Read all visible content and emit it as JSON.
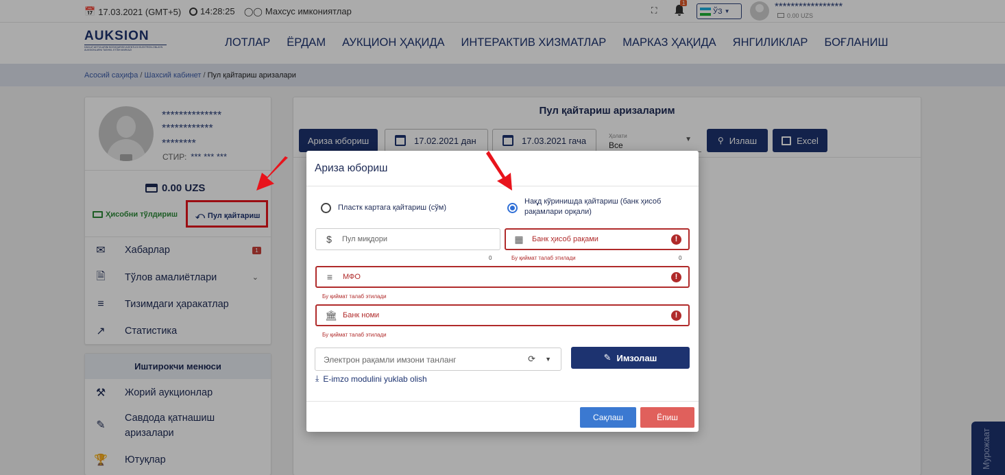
{
  "topbar": {
    "date": "17.03.2021 (GMT+5)",
    "time": "14:28:25",
    "accessibility": "Махсус имкониятлар",
    "notif_count": "1",
    "lang": "ЎЗ",
    "user_stars": "*****************",
    "balance": "0.00 UZS"
  },
  "nav": {
    "logo_text": "AUKSION",
    "logo_sub": "DAVLAT AKTIVLARINI BOSHQARISH AGENTLIGI ELEKTRON-ONLAYN AUKSIONLARNI TASHKIL ETISH MARKAZI",
    "links": [
      "ЛОТЛАР",
      "ЁРДАМ",
      "АУКЦИОН ҲАҚИДА",
      "ИНТЕРАКТИВ ХИЗМАТЛАР",
      "МАРКАЗ ҲАҚИДА",
      "ЯНГИЛИКЛАР",
      "БОҒЛАНИШ"
    ]
  },
  "breadcrumb": {
    "home": "Асосий саҳифа",
    "cabinet": "Шахсий кабинет",
    "current": "Пул қайтариш аризалари"
  },
  "profile": {
    "name_line1": "**************",
    "name_line2": "************",
    "name_line3": "********",
    "stir_label": "СТИР:",
    "stir_value": "*** *** ***",
    "balance": "0.00 UZS",
    "fill_label": "Ҳисобни тўлдириш",
    "refund_label": "Пул қайтариш"
  },
  "menu": [
    {
      "label": "Хабарлар",
      "badge": "1"
    },
    {
      "label": "Тўлов амалиётлари"
    },
    {
      "label": "Тизимдаги ҳаракатлар"
    },
    {
      "label": "Статистика"
    }
  ],
  "participant_menu": {
    "title": "Иштирокчи менюси",
    "items": [
      "Жорий аукционлар",
      "Савдода қатнашиш аризалари",
      "Ютуқлар"
    ]
  },
  "main": {
    "title": "Пул қайтариш аризаларим",
    "send_button": "Ариза юбориш",
    "date_from": "17.02.2021 дан",
    "date_to": "17.03.2021 гача",
    "status_label": "Ҳолати",
    "status_value": "Все",
    "search_button": "Излаш",
    "excel_button": "Excel"
  },
  "modal": {
    "title": "Ариза юбориш",
    "radio_card": "Пластк картага қайтариш (сўм)",
    "radio_cash": "Нақд кўринишда қайтариш (банк ҳисоб рақамлари орқали)",
    "amount_placeholder": "Пул миқдори",
    "amount_counter": "0",
    "account_placeholder": "Банк ҳисоб рақами",
    "account_counter": "0",
    "required_msg": "Бу қиймат талаб этилади",
    "mfo_placeholder": "МФО",
    "bank_placeholder": "Банк номи",
    "signature_placeholder": "Электрон рақамли имзони танланг",
    "sign_button": "Имзолаш",
    "download_link": "E-imzo modulini yuklab olish",
    "save_button": "Сақлаш",
    "close_button": "Ёпиш"
  },
  "side_tab": "Мурожаат",
  "colors": {
    "brand": "#1d3370",
    "error": "#b02a2a",
    "save": "#3b79d1",
    "close": "#e0605c",
    "annotation": "#e8141c"
  }
}
